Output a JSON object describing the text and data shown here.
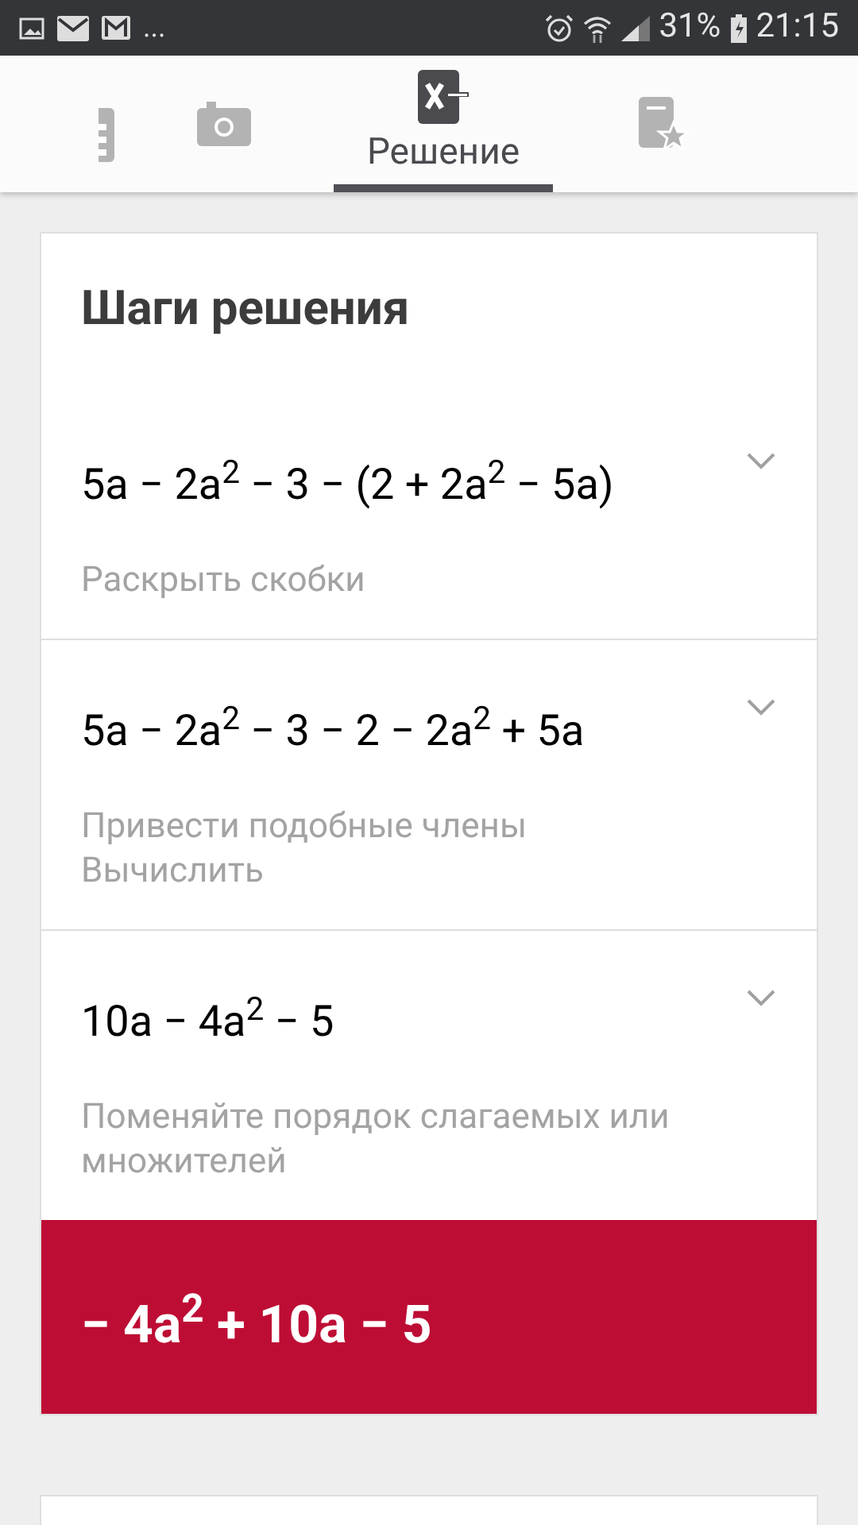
{
  "status_bar": {
    "overflow": "...",
    "battery": "31%",
    "time": "21:15"
  },
  "tabs": [
    {
      "kind": "calculator",
      "selected": false
    },
    {
      "kind": "camera",
      "selected": false
    },
    {
      "kind": "solver",
      "label": "Решение",
      "selected": true
    },
    {
      "kind": "notebook",
      "selected": false
    }
  ],
  "card": {
    "title": "Шаги решения",
    "steps": [
      {
        "expression": "5a − 2a$^{2}$ − 3 − (2 + 2a$^{2}$ − 5a)",
        "hints": [
          "Раскрыть скобки"
        ],
        "expanded": false
      },
      {
        "expression": "5a − 2a$^{2}$ − 3 − 2 − 2a$^{2}$ + 5a",
        "hints": [
          "Привести подобные члены",
          "Вычислить"
        ],
        "expanded": false
      },
      {
        "expression": "10a − 4a$^{2}$ − 5",
        "hints": [
          "Поменяйте порядок слагаемых или множителей"
        ],
        "expanded": false
      }
    ],
    "answer": "− 4a$^{2}$ + 10a − 5"
  }
}
